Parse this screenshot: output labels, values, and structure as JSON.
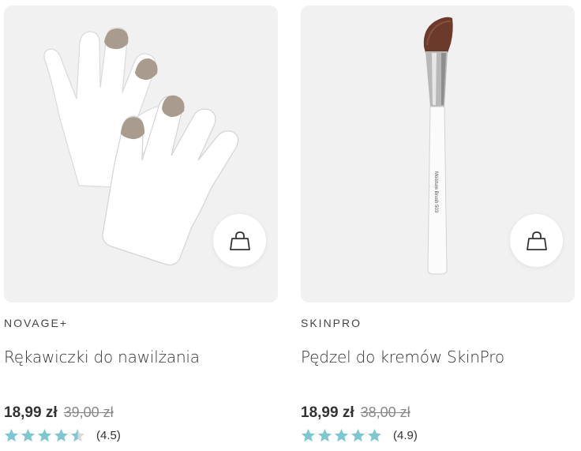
{
  "colors": {
    "star": "#7cc7d0",
    "star_empty": "#d9d9d9",
    "card_bg": "#f1f1f1"
  },
  "products": [
    {
      "brand": "NOVAGE+",
      "name": "Rękawiczki do nawilżania",
      "price": "18,99 zł",
      "old_price": "39,00 zł",
      "rating": 4.5,
      "rating_label": "(4.5)",
      "image": "moisturizing-gloves"
    },
    {
      "brand": "SKINPRO",
      "name": "Pędzel do kremów SkinPro",
      "price": "18,99 zł",
      "old_price": "38,00 zł",
      "rating": 4.9,
      "rating_label": "(4.9)",
      "image": "moisture-brush",
      "image_text": "Moisture Brush 503"
    }
  ]
}
